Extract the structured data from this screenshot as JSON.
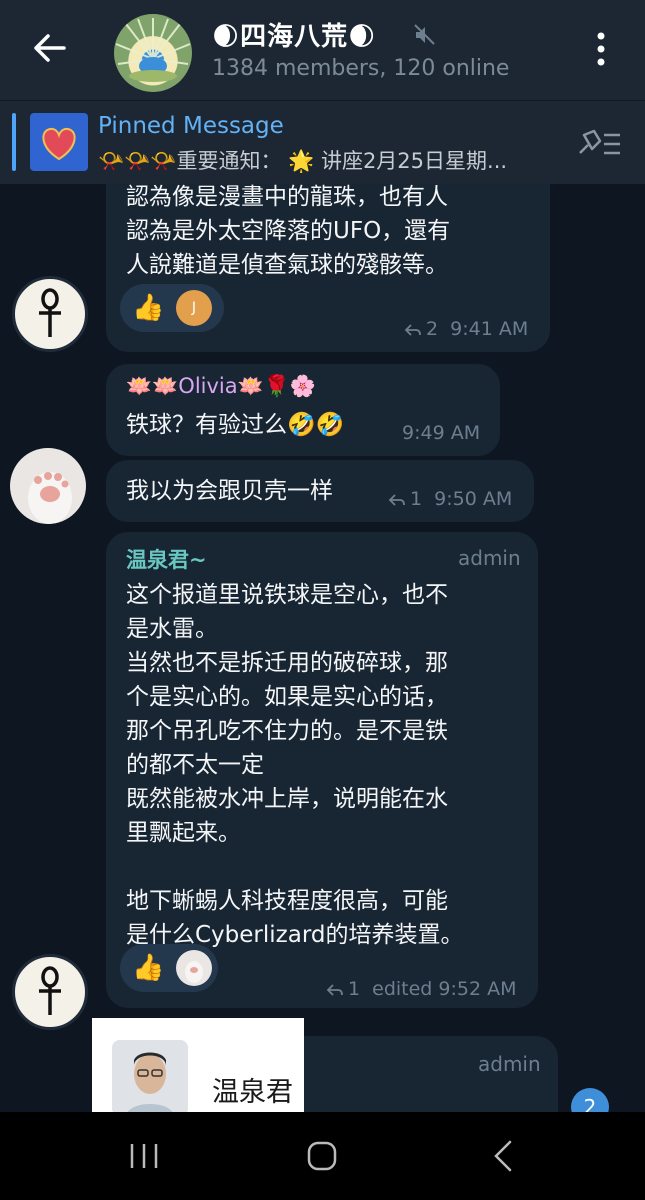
{
  "header": {
    "title": "🌒四海八荒🌒",
    "subtitle": "1384 members, 120 online",
    "back_icon": "arrow-left-icon",
    "mute_icon": "muted-speaker-icon",
    "more_icon": "more-vertical-icon"
  },
  "pinned": {
    "title": "Pinned Message",
    "text": "📯📯📯重要通知： 🌟 讲座2月25日星期..."
  },
  "messages": [
    {
      "text": "認為像是漫畫中的龍珠，也有人\n認為是外太空降落的UFO，還有\n人說難道是偵查氣球的殘骸等。",
      "reaction_emoji": "👍",
      "reaction_avatar_letter": "J",
      "replies": "2",
      "time": "9:41 AM"
    },
    {
      "sender": "🪷🪷Olivia🪷🌹🌸",
      "text": "铁球？有验过么🤣🤣",
      "time": "9:49 AM"
    },
    {
      "text": "我以为会跟贝壳一样",
      "replies": "1",
      "time": "9:50 AM"
    },
    {
      "sender": "温泉君~",
      "role": "admin",
      "text": "这个报道里说铁球是空心，也不\n是水雷。\n当然也不是拆迁用的破碎球，那\n个是实心的。如果是实心的话，\n那个吊孔吃不住力的。是不是铁\n的都不太一定\n既然能被水冲上岸，说明能在水\n里飘起来。\n\n地下蜥蜴人科技程度很高，可能\n是什么Cyberlizard的培养装置。",
      "reaction_emoji": "👍",
      "replies": "1",
      "edited_label": "edited",
      "time": "9:52 AM"
    },
    {
      "role": "admin"
    }
  ],
  "popup": {
    "name": "温泉君"
  },
  "unread_count": "2",
  "colors": {
    "background": "#0e1621",
    "header": "#1c2733",
    "bubble": "#182533",
    "accent": "#62b2f5",
    "olivia_name": "#d9a7f2",
    "admin_name": "#68c7c1"
  }
}
